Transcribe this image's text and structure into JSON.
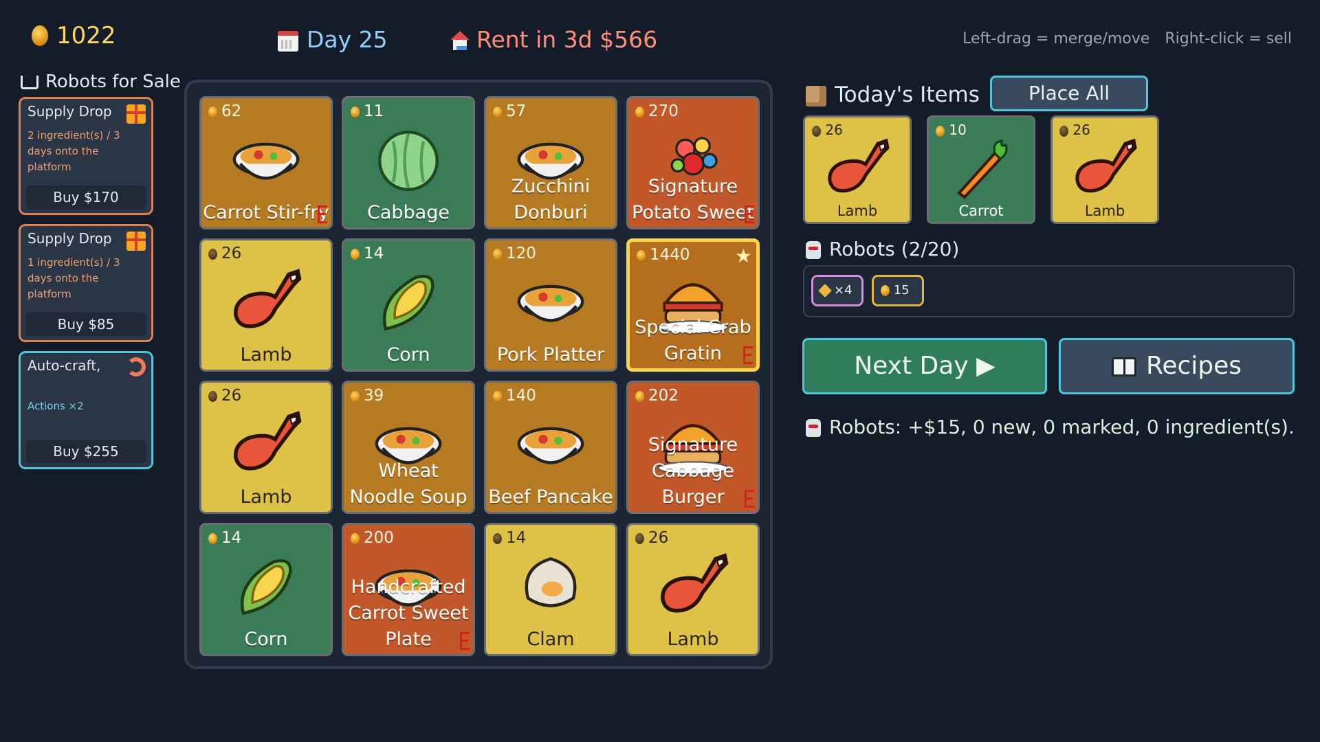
{
  "hud": {
    "money": "1022",
    "day": "Day 25",
    "rent": "Rent in 3d $566",
    "hint_merge": "Left-drag = merge/move",
    "hint_sell": "Right-click = sell"
  },
  "sale": {
    "title": "Robots for Sale",
    "cards": [
      {
        "title": "Supply Drop",
        "desc": "2 ingredient(s) / 3 days onto the platform",
        "buy": "Buy $170",
        "icon": "gift-icon"
      },
      {
        "title": "Supply Drop",
        "desc": "1 ingredient(s) / 3 days onto the platform",
        "buy": "Buy $85",
        "icon": "gift-icon"
      },
      {
        "title": "Auto-craft,",
        "desc": "Actions ×2",
        "buy": "Buy $255",
        "icon": "shrimp-icon"
      }
    ]
  },
  "board": {
    "tiles": [
      {
        "price": "62",
        "name": "Carrot Stir-fry",
        "color": "#b67a23",
        "icon": "stir-fry-icon"
      },
      {
        "price": "11",
        "name": "Cabbage",
        "color": "#3a7b58",
        "icon": "cabbage-icon"
      },
      {
        "price": "57",
        "name": "Zucchini Donburi",
        "color": "#b67a23",
        "icon": "donburi-icon"
      },
      {
        "price": "270",
        "name": "Signature Potato Sweet",
        "color": "#c2582a",
        "icon": "sweet-platter-icon"
      },
      {
        "price": "26",
        "name": "Lamb",
        "color": "#ddc247",
        "icon": "lamb-leg-icon"
      },
      {
        "price": "14",
        "name": "Corn",
        "color": "#3a7b58",
        "icon": "corn-icon"
      },
      {
        "price": "120",
        "name": "Pork Platter",
        "color": "#b67a23",
        "icon": "pork-platter-icon"
      },
      {
        "price": "1440",
        "name": "Special Crab Gratin",
        "color": "#b56e1e",
        "icon": "crab-gratin-icon"
      },
      {
        "price": "26",
        "name": "Lamb",
        "color": "#ddc247",
        "icon": "lamb-leg-icon"
      },
      {
        "price": "39",
        "name": "Wheat Noodle Soup",
        "color": "#b67a23",
        "icon": "noodle-soup-icon"
      },
      {
        "price": "140",
        "name": "Beef Pancake",
        "color": "#b67a23",
        "icon": "beef-pancake-icon"
      },
      {
        "price": "202",
        "name": "Signature Cabbage Burger",
        "color": "#c2582a",
        "icon": "burger-icon"
      },
      {
        "price": "14",
        "name": "Corn",
        "color": "#3a7b58",
        "icon": "corn-icon"
      },
      {
        "price": "200",
        "name": "Handcrafted Carrot Sweet Plate",
        "color": "#c2582a",
        "icon": "sweet-plate-icon"
      },
      {
        "price": "14",
        "name": "Clam",
        "color": "#ddc247",
        "icon": "clam-icon"
      },
      {
        "price": "26",
        "name": "Lamb",
        "color": "#ddc247",
        "icon": "lamb-leg-icon"
      }
    ]
  },
  "today": {
    "title": "Today's Items",
    "place_all": "Place All",
    "items": [
      {
        "price": "26",
        "name": "Lamb",
        "icon": "lamb-leg-icon"
      },
      {
        "price": "10",
        "name": "Carrot",
        "icon": "carrot-icon"
      },
      {
        "price": "26",
        "name": "Lamb",
        "icon": "lamb-leg-icon"
      }
    ]
  },
  "robots": {
    "title": "Robots (2/20)",
    "chip_tag": "×4",
    "chip_coin": "15"
  },
  "actions": {
    "next_day": "Next Day ▶",
    "recipes": "Recipes"
  },
  "log": "Robots: +$15, 0 new, 0 marked, 0 ingredient(s)."
}
